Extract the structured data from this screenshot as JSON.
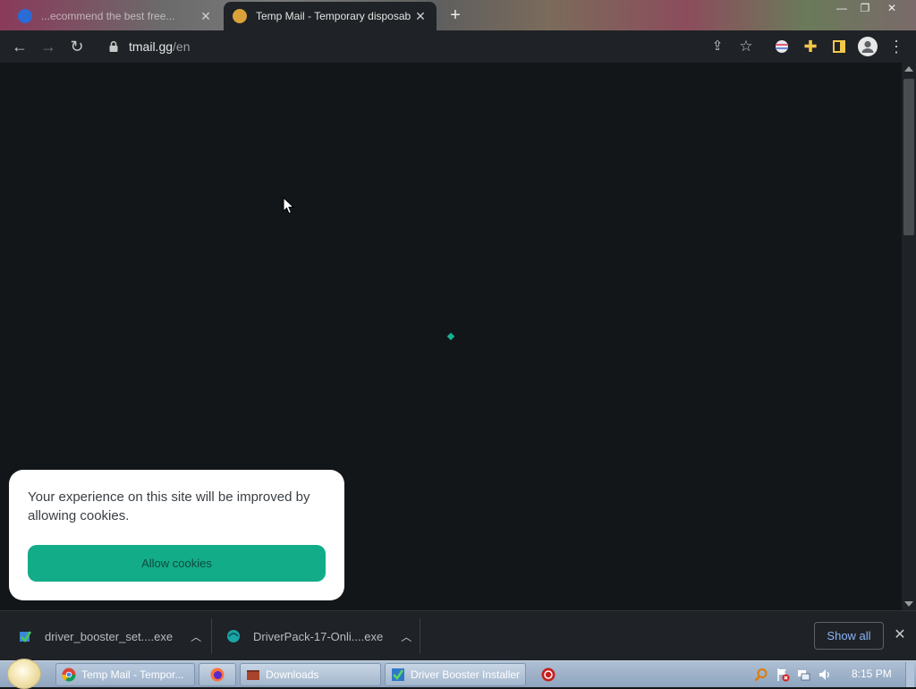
{
  "browser": {
    "tabs": [
      {
        "title": "...ecommend the best free...",
        "state": "inactive"
      },
      {
        "title": "Temp Mail - Temporary disposab",
        "state": "active"
      }
    ],
    "address": {
      "host": "tmail.gg",
      "path": "/en"
    }
  },
  "cookie_banner": {
    "message": "Your experience on this site will be improved by allowing cookies.",
    "button_label": "Allow cookies"
  },
  "downloads": {
    "items": [
      {
        "filename": "driver_booster_set....exe"
      },
      {
        "filename": "DriverPack-17-Onli....exe"
      }
    ],
    "show_all_label": "Show all"
  },
  "taskbar": {
    "buttons": [
      {
        "label": "Temp Mail - Tempor..."
      },
      {
        "label": ""
      },
      {
        "label": "Downloads"
      },
      {
        "label": "Driver Booster Installer"
      }
    ],
    "clock": "8:15 PM"
  },
  "colors": {
    "accent": "#13ac89",
    "page_background": "#121619",
    "toolbar": "#1f2226",
    "link": "#8ab4f8"
  }
}
